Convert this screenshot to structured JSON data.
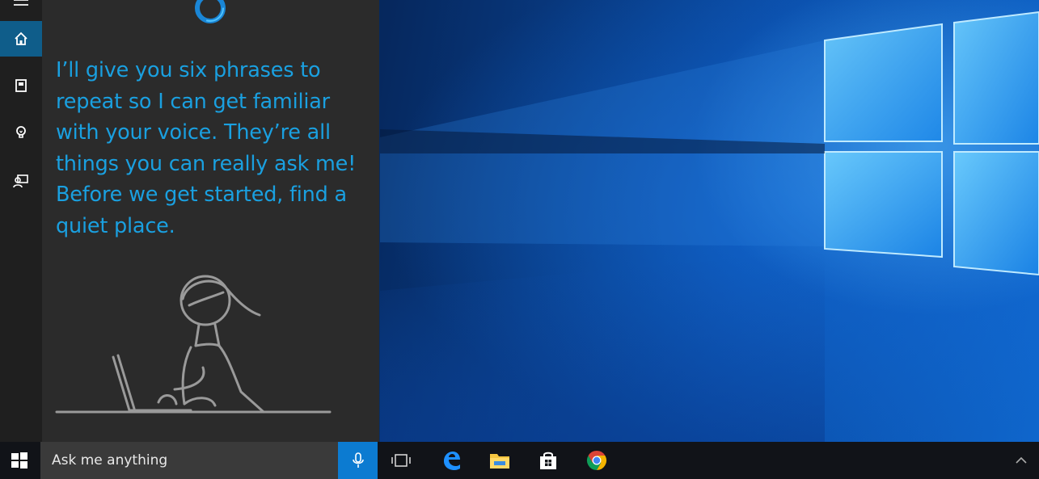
{
  "cortana": {
    "message": "I’ll give you six phrases to repeat so I can get familiar with your voice. They’re all things you can really ask me! Before we get started, find a quiet place.",
    "accent_color": "#1aa0e0",
    "rail_items": [
      {
        "icon": "home-icon",
        "active": true
      },
      {
        "icon": "notebook-icon",
        "active": false
      },
      {
        "icon": "lightbulb-icon",
        "active": false
      },
      {
        "icon": "feedback-icon",
        "active": false
      }
    ],
    "illustration": "person-at-laptop-illustration"
  },
  "taskbar": {
    "search_placeholder": "Ask me anything",
    "pinned": [
      {
        "icon": "task-view-icon"
      },
      {
        "icon": "edge-icon"
      },
      {
        "icon": "file-explorer-icon"
      },
      {
        "icon": "store-icon"
      },
      {
        "icon": "chrome-icon"
      }
    ],
    "tray_icon": "chevron-up-icon"
  },
  "desktop": {
    "wallpaper": "windows-10-hero-wallpaper"
  }
}
